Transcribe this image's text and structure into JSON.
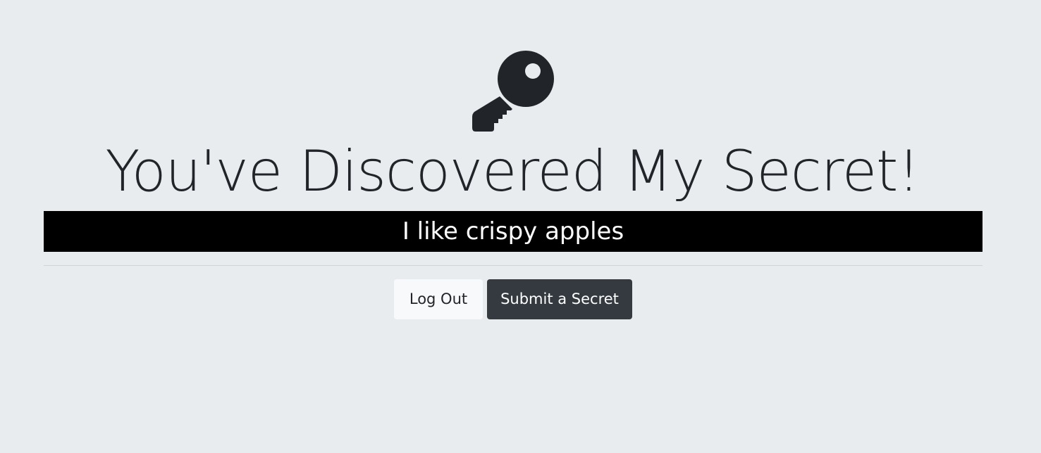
{
  "page": {
    "title": "You've Discovered My Secret!",
    "secret_text": "I like crispy apples"
  },
  "icons": {
    "hero": "key-icon"
  },
  "actions": {
    "logout_label": "Log Out",
    "submit_label": "Submit a Secret"
  },
  "colors": {
    "background": "#e9ecef",
    "secret_bar": "#000000",
    "dark_button": "#343a40",
    "light_button": "#f8f9fa",
    "text": "#212529"
  }
}
